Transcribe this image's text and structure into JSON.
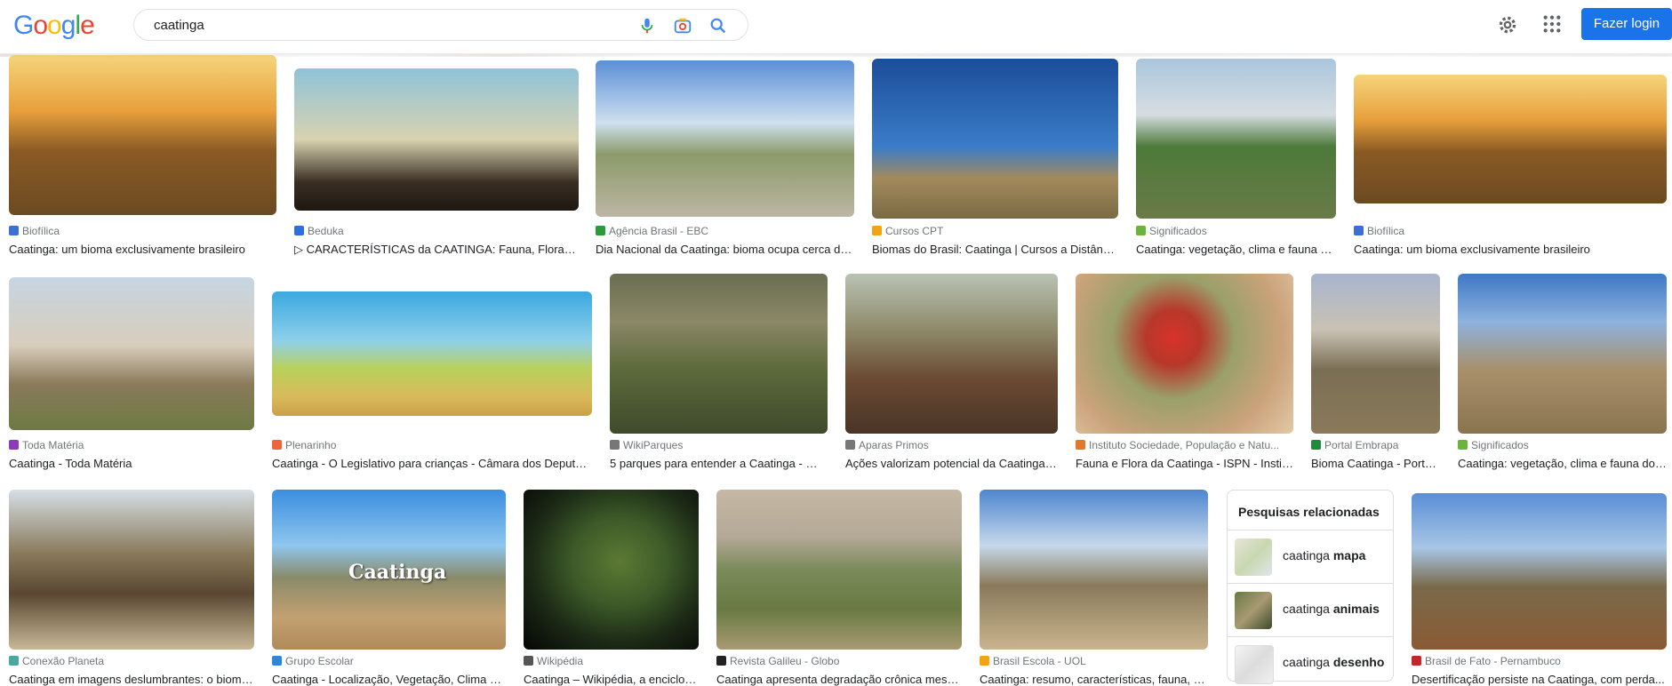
{
  "header": {
    "logo_letters": [
      "G",
      "o",
      "o",
      "g",
      "l",
      "e"
    ],
    "logo_colors": [
      "#4285F4",
      "#EA4335",
      "#FBBC05",
      "#4285F4",
      "#34A853",
      "#EA4335"
    ],
    "search_value": "caatinga",
    "login_label": "Fazer login"
  },
  "results": [
    {
      "source": "Biofílica",
      "title": "Caatinga: um bioma exclusivamente brasileiro",
      "fav": "#3b6fd6"
    },
    {
      "source": "Beduka",
      "title": "▷ CARACTERÍSTICAS da CAATINGA: Fauna, Flora, Clim...",
      "fav": "#2e6fe0"
    },
    {
      "source": "Agência Brasil - EBC",
      "title": "Dia Nacional da Caatinga: bioma ocupa cerca de ...",
      "fav": "#2b9a3a"
    },
    {
      "source": "Cursos CPT",
      "title": "Biomas do Brasil: Caatinga | Cursos a Distânci...",
      "fav": "#f2a316"
    },
    {
      "source": "Significados",
      "title": "Caatinga: vegetação, clima e fauna do...",
      "fav": "#6cb33e"
    },
    {
      "source": "Biofílica",
      "title": "Caatinga: um bioma exclusivamente brasileiro",
      "fav": "#3b6fd6"
    },
    {
      "source": "Toda Matéria",
      "title": "Caatinga - Toda Matéria",
      "fav": "#8c3bb8"
    },
    {
      "source": "Plenarinho",
      "title": "Caatinga - O Legislativo para crianças - Câmara dos Deputados",
      "fav": "#f0643c"
    },
    {
      "source": "WikiParques",
      "title": "5 parques para entender a Caatinga - Wik...",
      "fav": "#777777"
    },
    {
      "source": "Aparas Primos",
      "title": "Ações valorizam potencial da Caatinga -...",
      "fav": "#777777"
    },
    {
      "source": "Instituto Sociedade, População e Natu...",
      "title": "Fauna e Flora da Caatinga - ISPN - Institu...",
      "fav": "#e0782a"
    },
    {
      "source": "Portal Embrapa",
      "title": "Bioma Caatinga - Porta...",
      "fav": "#1e8a3c"
    },
    {
      "source": "Significados",
      "title": "Caatinga: vegetação, clima e fauna do ...",
      "fav": "#6cb33e"
    },
    {
      "source": "Conexão Planeta",
      "title": "Caatinga em imagens deslumbrantes: o bioma...",
      "fav": "#4aa8a0"
    },
    {
      "source": "Grupo Escolar",
      "title": "Caatinga - Localização, Vegetação, Clima e F...",
      "fav": "#2e86d6"
    },
    {
      "source": "Wikipédia",
      "title": "Caatinga – Wikipédia, a enciclop...",
      "fav": "#555555"
    },
    {
      "source": "Revista Galileu - Globo",
      "title": "Caatinga apresenta degradação crônica mesm...",
      "fav": "#222222"
    },
    {
      "source": "Brasil Escola - UOL",
      "title": "Caatinga: resumo, características, fauna, ve...",
      "fav": "#f2a316"
    },
    {
      "source": "Brasil de Fato - Pernambuco",
      "title": "Desertificação persiste na Caatinga, com perda...",
      "fav": "#c0282a"
    }
  ],
  "related": {
    "heading": "Pesquisas relacionadas",
    "items": [
      {
        "prefix": "caatinga",
        "bold": "mapa"
      },
      {
        "prefix": "caatinga",
        "bold": "animais"
      },
      {
        "prefix": "caatinga",
        "bold": "desenho"
      }
    ]
  },
  "overlay_badge": "Caatinga"
}
